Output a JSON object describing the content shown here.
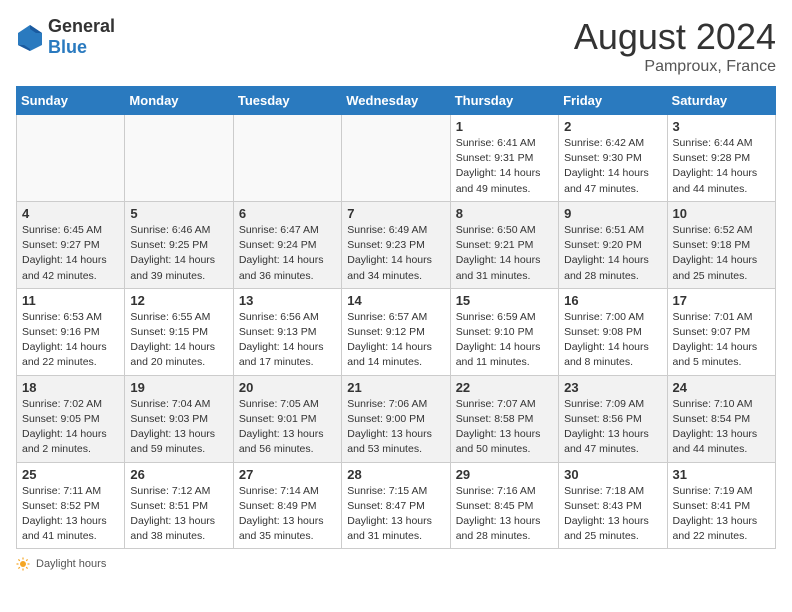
{
  "header": {
    "logo_general": "General",
    "logo_blue": "Blue",
    "month_year": "August 2024",
    "location": "Pamproux, France"
  },
  "days_of_week": [
    "Sunday",
    "Monday",
    "Tuesday",
    "Wednesday",
    "Thursday",
    "Friday",
    "Saturday"
  ],
  "weeks": [
    [
      {
        "day": "",
        "info": ""
      },
      {
        "day": "",
        "info": ""
      },
      {
        "day": "",
        "info": ""
      },
      {
        "day": "",
        "info": ""
      },
      {
        "day": "1",
        "info": "Sunrise: 6:41 AM\nSunset: 9:31 PM\nDaylight: 14 hours and 49 minutes."
      },
      {
        "day": "2",
        "info": "Sunrise: 6:42 AM\nSunset: 9:30 PM\nDaylight: 14 hours and 47 minutes."
      },
      {
        "day": "3",
        "info": "Sunrise: 6:44 AM\nSunset: 9:28 PM\nDaylight: 14 hours and 44 minutes."
      }
    ],
    [
      {
        "day": "4",
        "info": "Sunrise: 6:45 AM\nSunset: 9:27 PM\nDaylight: 14 hours and 42 minutes."
      },
      {
        "day": "5",
        "info": "Sunrise: 6:46 AM\nSunset: 9:25 PM\nDaylight: 14 hours and 39 minutes."
      },
      {
        "day": "6",
        "info": "Sunrise: 6:47 AM\nSunset: 9:24 PM\nDaylight: 14 hours and 36 minutes."
      },
      {
        "day": "7",
        "info": "Sunrise: 6:49 AM\nSunset: 9:23 PM\nDaylight: 14 hours and 34 minutes."
      },
      {
        "day": "8",
        "info": "Sunrise: 6:50 AM\nSunset: 9:21 PM\nDaylight: 14 hours and 31 minutes."
      },
      {
        "day": "9",
        "info": "Sunrise: 6:51 AM\nSunset: 9:20 PM\nDaylight: 14 hours and 28 minutes."
      },
      {
        "day": "10",
        "info": "Sunrise: 6:52 AM\nSunset: 9:18 PM\nDaylight: 14 hours and 25 minutes."
      }
    ],
    [
      {
        "day": "11",
        "info": "Sunrise: 6:53 AM\nSunset: 9:16 PM\nDaylight: 14 hours and 22 minutes."
      },
      {
        "day": "12",
        "info": "Sunrise: 6:55 AM\nSunset: 9:15 PM\nDaylight: 14 hours and 20 minutes."
      },
      {
        "day": "13",
        "info": "Sunrise: 6:56 AM\nSunset: 9:13 PM\nDaylight: 14 hours and 17 minutes."
      },
      {
        "day": "14",
        "info": "Sunrise: 6:57 AM\nSunset: 9:12 PM\nDaylight: 14 hours and 14 minutes."
      },
      {
        "day": "15",
        "info": "Sunrise: 6:59 AM\nSunset: 9:10 PM\nDaylight: 14 hours and 11 minutes."
      },
      {
        "day": "16",
        "info": "Sunrise: 7:00 AM\nSunset: 9:08 PM\nDaylight: 14 hours and 8 minutes."
      },
      {
        "day": "17",
        "info": "Sunrise: 7:01 AM\nSunset: 9:07 PM\nDaylight: 14 hours and 5 minutes."
      }
    ],
    [
      {
        "day": "18",
        "info": "Sunrise: 7:02 AM\nSunset: 9:05 PM\nDaylight: 14 hours and 2 minutes."
      },
      {
        "day": "19",
        "info": "Sunrise: 7:04 AM\nSunset: 9:03 PM\nDaylight: 13 hours and 59 minutes."
      },
      {
        "day": "20",
        "info": "Sunrise: 7:05 AM\nSunset: 9:01 PM\nDaylight: 13 hours and 56 minutes."
      },
      {
        "day": "21",
        "info": "Sunrise: 7:06 AM\nSunset: 9:00 PM\nDaylight: 13 hours and 53 minutes."
      },
      {
        "day": "22",
        "info": "Sunrise: 7:07 AM\nSunset: 8:58 PM\nDaylight: 13 hours and 50 minutes."
      },
      {
        "day": "23",
        "info": "Sunrise: 7:09 AM\nSunset: 8:56 PM\nDaylight: 13 hours and 47 minutes."
      },
      {
        "day": "24",
        "info": "Sunrise: 7:10 AM\nSunset: 8:54 PM\nDaylight: 13 hours and 44 minutes."
      }
    ],
    [
      {
        "day": "25",
        "info": "Sunrise: 7:11 AM\nSunset: 8:52 PM\nDaylight: 13 hours and 41 minutes."
      },
      {
        "day": "26",
        "info": "Sunrise: 7:12 AM\nSunset: 8:51 PM\nDaylight: 13 hours and 38 minutes."
      },
      {
        "day": "27",
        "info": "Sunrise: 7:14 AM\nSunset: 8:49 PM\nDaylight: 13 hours and 35 minutes."
      },
      {
        "day": "28",
        "info": "Sunrise: 7:15 AM\nSunset: 8:47 PM\nDaylight: 13 hours and 31 minutes."
      },
      {
        "day": "29",
        "info": "Sunrise: 7:16 AM\nSunset: 8:45 PM\nDaylight: 13 hours and 28 minutes."
      },
      {
        "day": "30",
        "info": "Sunrise: 7:18 AM\nSunset: 8:43 PM\nDaylight: 13 hours and 25 minutes."
      },
      {
        "day": "31",
        "info": "Sunrise: 7:19 AM\nSunset: 8:41 PM\nDaylight: 13 hours and 22 minutes."
      }
    ]
  ],
  "footer": {
    "label": "Daylight hours"
  }
}
